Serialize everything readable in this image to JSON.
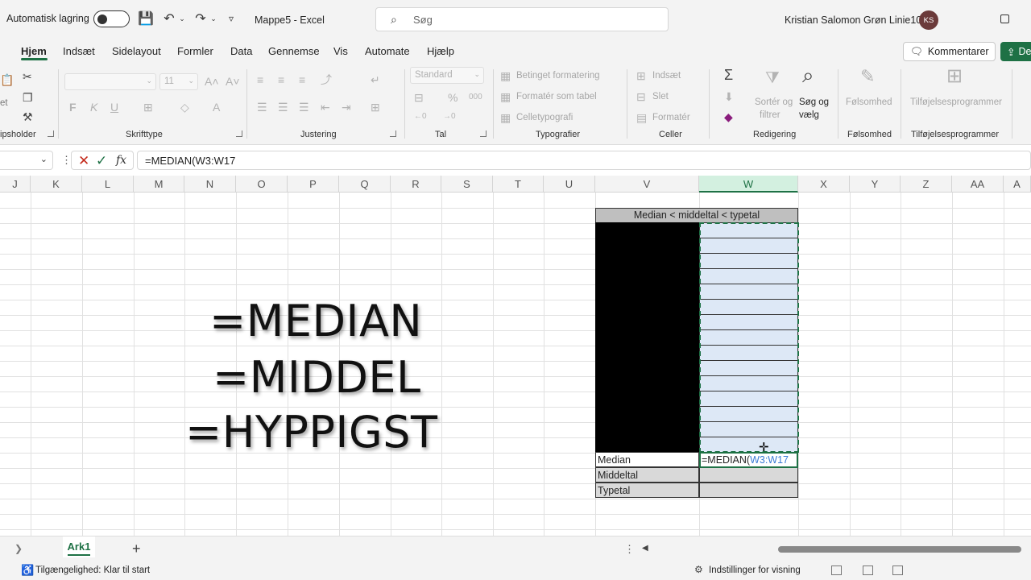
{
  "titlebar": {
    "autosave_label": "Automatisk lagring",
    "doc_title": "Mappe5  -  Excel",
    "search_placeholder": "Søg",
    "user_name": "Kristian Salomon Grøn Linie10",
    "user_initials": "KS"
  },
  "ribbon_tabs": [
    "Hjem",
    "Indsæt",
    "Sidelayout",
    "Formler",
    "Data",
    "Gennemse",
    "Vis",
    "Automate",
    "Hjælp"
  ],
  "active_tab": "Hjem",
  "actions": {
    "comments": "Kommentarer",
    "share": "De"
  },
  "ribbon": {
    "groups": {
      "clipboard": "ipsholder",
      "font": "Skrifttype",
      "alignment": "Justering",
      "number": "Tal",
      "styles": "Typografier",
      "cells": "Celler",
      "editing": "Redigering",
      "sensitivity": "Følsomhed",
      "addins": "Tilføjelsesprogrammer"
    },
    "font_size": "11",
    "number_format": "Standard",
    "font_buttons": {
      "bold": "F",
      "italic": "K",
      "underline": "U"
    },
    "styles_items": [
      "Betinget formatering",
      "Formatér som tabel",
      "Celletypografi"
    ],
    "cells_items": [
      "Indsæt",
      "Slet",
      "Formatér"
    ],
    "editing": {
      "sort_line1": "Sortér og",
      "sort_line2": "filtrer",
      "find_line1": "Søg og",
      "find_line2": "vælg"
    },
    "sensitivity_btn": "Følsomhed",
    "addins_btn": "Tilføjelsesprogrammer",
    "clipboard_partial": "et"
  },
  "formula_bar": {
    "formula": "=MEDIAN(W3:W17",
    "fx": "fx"
  },
  "columns": [
    "J",
    "K",
    "L",
    "M",
    "N",
    "O",
    "P",
    "Q",
    "R",
    "S",
    "T",
    "U",
    "V",
    "W",
    "X",
    "Y",
    "Z",
    "AA",
    "A"
  ],
  "selected_column": "W",
  "sheet_table": {
    "title": "Median < middeltal < typetal",
    "row_labels": [
      "Median",
      "Middeltal",
      "Typetal"
    ],
    "editing_cell": {
      "func": "=MEDIAN(",
      "ref": "W3:W17"
    }
  },
  "overlay_text": [
    "=MEDIAN",
    "=MIDDEL",
    "=HYPPIGST"
  ],
  "sheet_tabs": {
    "active": "Ark1",
    "add": "+"
  },
  "status": {
    "accessibility": "Tilgængelighed: Klar til start",
    "display_settings": "Indstillinger for visning"
  }
}
